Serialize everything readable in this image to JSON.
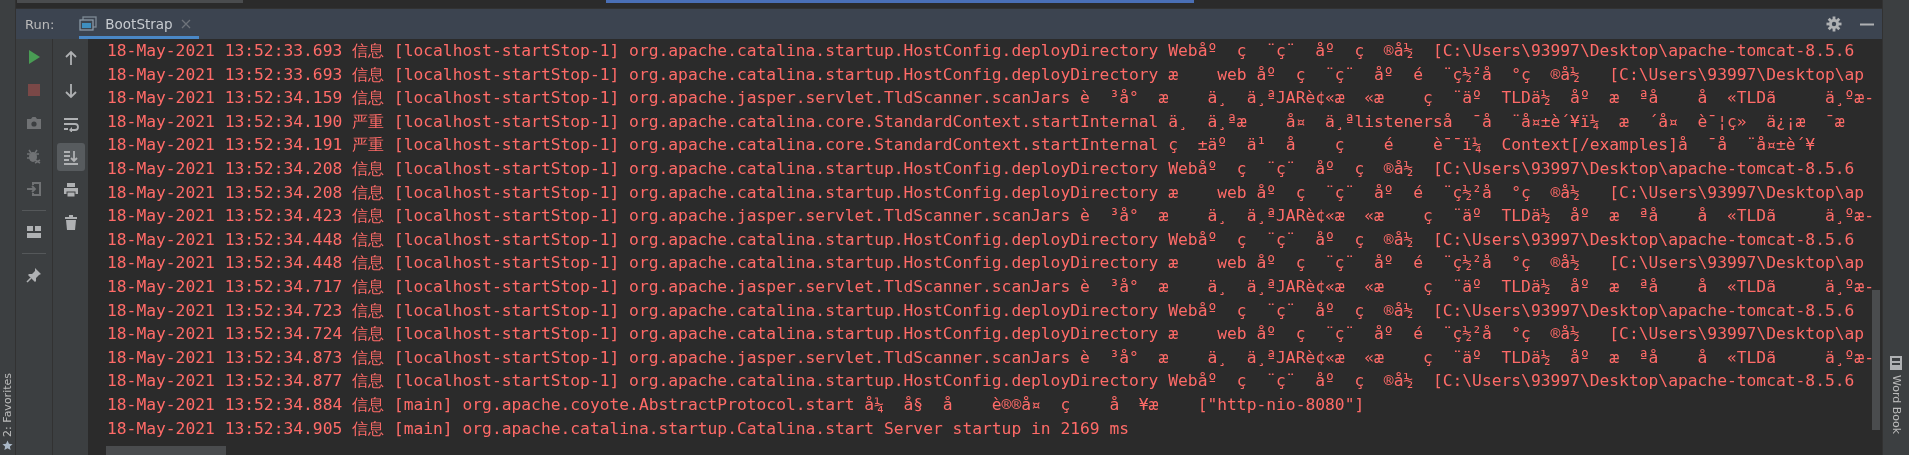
{
  "favorites_bar": {
    "label": "2: Favorites"
  },
  "run_panel": {
    "title": "Run:",
    "tabs": [
      {
        "label": "BootStrap",
        "selected": true
      }
    ]
  },
  "main_toolbar": [
    {
      "kind": "run",
      "disabled": false
    },
    {
      "kind": "stop",
      "disabled": true
    },
    {
      "kind": "camera",
      "disabled": true
    },
    {
      "kind": "bug",
      "disabled": true
    },
    {
      "kind": "exit",
      "disabled": true
    },
    {
      "kind": "separator"
    },
    {
      "kind": "layout",
      "disabled": false
    },
    {
      "kind": "separator"
    },
    {
      "kind": "pin",
      "disabled": false
    }
  ],
  "console_toolbar": [
    {
      "kind": "up",
      "on": false
    },
    {
      "kind": "down",
      "on": false
    },
    {
      "kind": "wrap",
      "on": false
    },
    {
      "kind": "scroll-end",
      "on": true
    },
    {
      "kind": "print",
      "on": false
    },
    {
      "kind": "trash",
      "on": false
    }
  ],
  "log_lines": [
    {
      "text": "18-May-2021 13:52:33.693 信息 [localhost-startStop-1] org.apache.catalina.startup.HostConfig.deployDirectory Webåº  ç  ¨ç¨  åº  ç  ®å½  [C:\\Users\\93997\\Desktop\\apache-tomcat-8.5.6"
    },
    {
      "text": "18-May-2021 13:52:33.693 信息 [localhost-startStop-1] org.apache.catalina.startup.HostConfig.deployDirectory æ    web åº  ç  ¨ç¨  åº  é  ¨ç½²å  °ç  ®å½   [C:\\Users\\93997\\Desktop\\ap"
    },
    {
      "text": "18-May-2021 13:52:34.159 信息 [localhost-startStop-1] org.apache.jasper.servlet.TldScanner.scanJars è  ³å°  æ    ä¸  ä¸ªJARè¢«æ  «æ    ç  ¨äº  TLDä½  åº  æ  ªå    å  «TLDã     ä¸ºæ-"
    },
    {
      "text": "18-May-2021 13:52:34.190 严重 [localhost-startStop-1] org.apache.catalina.core.StandardContext.startInternal ä¸  ä¸ªæ    å¤  ä¸ªlistenerså  ¯å  ¨å¤±è´¥ï¼  æ  ´å¤  è¯¦ç»  ä¿¡æ  ¯æ"
    },
    {
      "text": "18-May-2021 13:52:34.191 严重 [localhost-startStop-1] org.apache.catalina.core.StandardContext.startInternal ç  ±äº  ä¹  å    ç    é    è¯¯ï¼  Context[/examples]å  ¯å  ¨å¤±è´¥"
    },
    {
      "text": "18-May-2021 13:52:34.208 信息 [localhost-startStop-1] org.apache.catalina.startup.HostConfig.deployDirectory Webåº  ç  ¨ç¨  åº  ç  ®å½  [C:\\Users\\93997\\Desktop\\apache-tomcat-8.5.6"
    },
    {
      "text": "18-May-2021 13:52:34.208 信息 [localhost-startStop-1] org.apache.catalina.startup.HostConfig.deployDirectory æ    web åº  ç  ¨ç¨  åº  é  ¨ç½²å  °ç  ®å½   [C:\\Users\\93997\\Desktop\\ap"
    },
    {
      "text": "18-May-2021 13:52:34.423 信息 [localhost-startStop-1] org.apache.jasper.servlet.TldScanner.scanJars è  ³å°  æ    ä¸  ä¸ªJARè¢«æ  «æ    ç  ¨äº  TLDä½  åº  æ  ªå    å  «TLDã     ä¸ºæ-"
    },
    {
      "text": "18-May-2021 13:52:34.448 信息 [localhost-startStop-1] org.apache.catalina.startup.HostConfig.deployDirectory Webåº  ç  ¨ç¨  åº  ç  ®å½  [C:\\Users\\93997\\Desktop\\apache-tomcat-8.5.6"
    },
    {
      "text": "18-May-2021 13:52:34.448 信息 [localhost-startStop-1] org.apache.catalina.startup.HostConfig.deployDirectory æ    web åº  ç  ¨ç¨  åº  é  ¨ç½²å  °ç  ®å½   [C:\\Users\\93997\\Desktop\\ap"
    },
    {
      "text": "18-May-2021 13:52:34.717 信息 [localhost-startStop-1] org.apache.jasper.servlet.TldScanner.scanJars è  ³å°  æ    ä¸  ä¸ªJARè¢«æ  «æ    ç  ¨äº  TLDä½  åº  æ  ªå    å  «TLDã     ä¸ºæ-"
    },
    {
      "text": "18-May-2021 13:52:34.723 信息 [localhost-startStop-1] org.apache.catalina.startup.HostConfig.deployDirectory Webåº  ç  ¨ç¨  åº  ç  ®å½  [C:\\Users\\93997\\Desktop\\apache-tomcat-8.5.6"
    },
    {
      "text": "18-May-2021 13:52:34.724 信息 [localhost-startStop-1] org.apache.catalina.startup.HostConfig.deployDirectory æ    web åº  ç  ¨ç¨  åº  é  ¨ç½²å  °ç  ®å½   [C:\\Users\\93997\\Desktop\\ap"
    },
    {
      "text": "18-May-2021 13:52:34.873 信息 [localhost-startStop-1] org.apache.jasper.servlet.TldScanner.scanJars è  ³å°  æ    ä¸  ä¸ªJARè¢«æ  «æ    ç  ¨äº  TLDä½  åº  æ  ªå    å  «TLDã     ä¸ºæ-"
    },
    {
      "text": "18-May-2021 13:52:34.877 信息 [localhost-startStop-1] org.apache.catalina.startup.HostConfig.deployDirectory Webåº  ç  ¨ç¨  åº  ç  ®å½  [C:\\Users\\93997\\Desktop\\apache-tomcat-8.5.6"
    },
    {
      "text": "18-May-2021 13:52:34.884 信息 [main] org.apache.coyote.AbstractProtocol.start å¼  å§  å    è®®å¤  ç    å  ¥æ    [\"http-nio-8080\"]"
    },
    {
      "text": "18-May-2021 13:52:34.905 信息 [main] org.apache.catalina.startup.Catalina.start Server startup in 2169 ms"
    }
  ],
  "right_bar": {
    "label": "Word Book"
  }
}
